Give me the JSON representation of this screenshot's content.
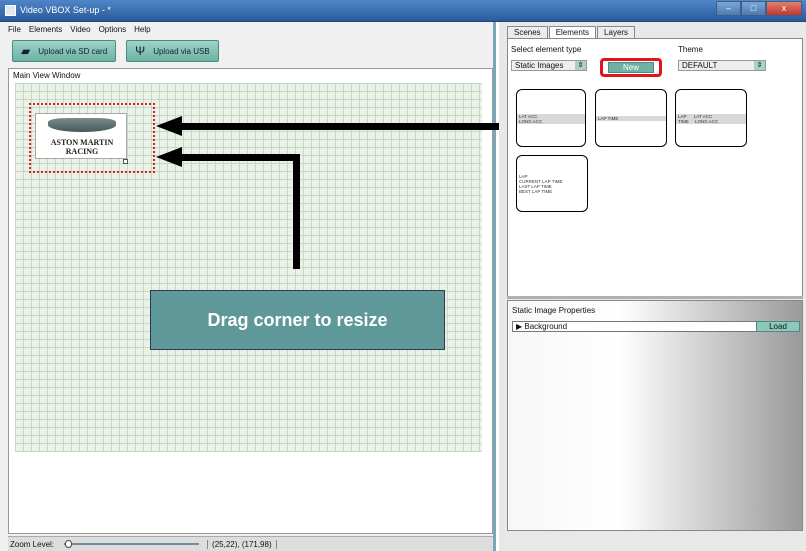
{
  "window": {
    "title": "Video VBOX Set-up - *",
    "min": "–",
    "max": "□",
    "close": "x"
  },
  "menu": [
    "File",
    "Elements",
    "Video",
    "Options",
    "Help"
  ],
  "toolbar": {
    "sd_label": "Upload via SD card",
    "usb_label": "Upload via USB"
  },
  "main_view": {
    "label": "Main View Window",
    "logo_text": "ASTON MARTIN RACING"
  },
  "callout": "Drag corner to resize",
  "zoom": {
    "label": "Zoom Level:",
    "coords": "(25,22), (171,98)"
  },
  "tabs": [
    "Scenes",
    "Elements",
    "Layers"
  ],
  "elements_panel": {
    "select_label": "Select element type",
    "select_value": "Static Images",
    "new_button": "New",
    "theme_label": "Theme",
    "theme_value": "DEFAULT",
    "thumbnails": [
      {
        "lines": "LAT ACC\nLONG ACC"
      },
      {
        "lines": "LAP TIME"
      },
      {
        "lines": "LAP      LAT ACC\nTIME     LONG ACC"
      },
      {
        "lines": "LAP\nCURRENT LAP TIME\nLAST LAP TIME\nBEST LAP TIME"
      }
    ]
  },
  "properties": {
    "title": "Static Image Properties",
    "row_label": "▶ Background",
    "load_button": "Load"
  }
}
